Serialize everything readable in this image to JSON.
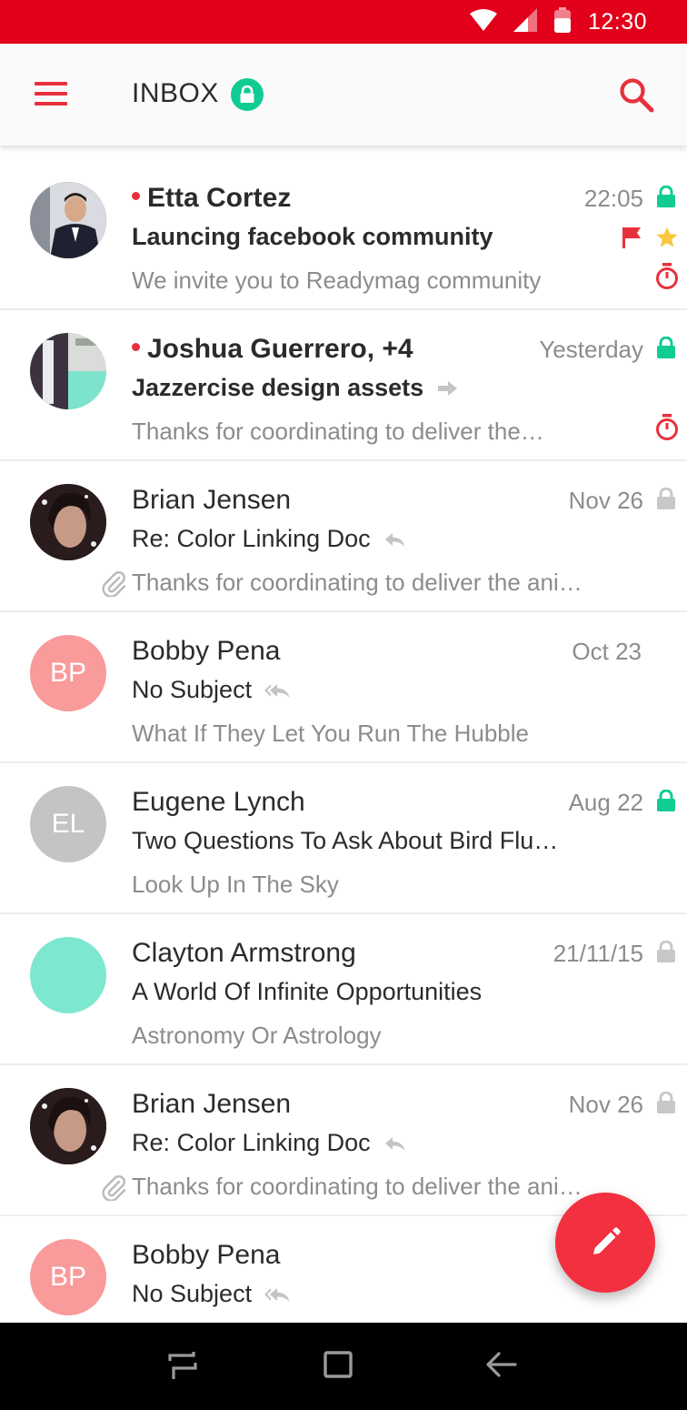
{
  "status_bar": {
    "time": "12:30"
  },
  "header": {
    "title": "INBOX"
  },
  "emails": [
    {
      "sender": "Etta Cortez",
      "unread": true,
      "subject": "Launcing facebook community",
      "preview": "We invite you to Readymag community",
      "date": "22:05",
      "lock": "green",
      "flag": true,
      "star": true,
      "timer": true,
      "attachment": false,
      "subject_icon": "",
      "avatar_type": "photo",
      "avatar_initials": "",
      "avatar_color": "#2c2f3a"
    },
    {
      "sender": "Joshua Guerrero, +4",
      "unread": true,
      "subject": "Jazzercise design assets",
      "preview": "Thanks for coordinating to deliver the…",
      "date": "Yesterday",
      "lock": "green",
      "flag": false,
      "star": false,
      "timer": true,
      "attachment": false,
      "subject_icon": "forward-icon",
      "avatar_type": "group",
      "avatar_initials": "",
      "avatar_color": "#7ee3cc"
    },
    {
      "sender": "Brian Jensen",
      "unread": false,
      "subject": "Re: Color Linking Doc",
      "preview": "Thanks for coordinating to deliver the ani…",
      "date": "Nov 26",
      "lock": "grey",
      "flag": false,
      "star": false,
      "timer": false,
      "attachment": true,
      "subject_icon": "reply-icon",
      "avatar_type": "photo",
      "avatar_initials": "",
      "avatar_color": "#3a2a2a"
    },
    {
      "sender": "Bobby Pena",
      "unread": false,
      "subject": "No Subject",
      "preview": "What If They Let You Run The Hubble",
      "date": "Oct 23",
      "lock": "none",
      "flag": false,
      "star": false,
      "timer": false,
      "attachment": false,
      "subject_icon": "reply-all-icon",
      "avatar_type": "initials",
      "avatar_initials": "BP",
      "avatar_color": "#f99a9b"
    },
    {
      "sender": "Eugene Lynch",
      "unread": false,
      "subject": "Two Questions To Ask About Bird Flu…",
      "preview": "Look Up In The Sky",
      "date": "Aug 22",
      "lock": "green",
      "flag": false,
      "star": false,
      "timer": false,
      "attachment": false,
      "subject_icon": "",
      "avatar_type": "initials",
      "avatar_initials": "EL",
      "avatar_color": "#c4c4c4"
    },
    {
      "sender": "Clayton Armstrong",
      "unread": false,
      "subject": "A World Of Infinite Opportunities",
      "preview": "Astronomy Or Astrology",
      "date": "21/11/15",
      "lock": "grey",
      "flag": false,
      "star": false,
      "timer": false,
      "attachment": false,
      "subject_icon": "",
      "avatar_type": "initials",
      "avatar_initials": "",
      "avatar_color": "#7ee7cf"
    },
    {
      "sender": "Brian Jensen",
      "unread": false,
      "subject": "Re: Color Linking Doc",
      "preview": "Thanks for coordinating to deliver the ani…",
      "date": "Nov 26",
      "lock": "grey",
      "flag": false,
      "star": false,
      "timer": false,
      "attachment": true,
      "subject_icon": "reply-icon",
      "avatar_type": "photo",
      "avatar_initials": "",
      "avatar_color": "#3a2a2a"
    },
    {
      "sender": "Bobby Pena",
      "unread": false,
      "subject": "No Subject",
      "preview": "",
      "date": "",
      "lock": "none",
      "flag": false,
      "star": false,
      "timer": false,
      "attachment": false,
      "subject_icon": "reply-all-icon",
      "avatar_type": "initials",
      "avatar_initials": "BP",
      "avatar_color": "#f99a9b"
    }
  ],
  "colors": {
    "accent": "#e2001a",
    "lock_green": "#10cc93",
    "lock_grey": "#c8c8c8",
    "flag": "#e8303d",
    "star": "#f9c640"
  }
}
